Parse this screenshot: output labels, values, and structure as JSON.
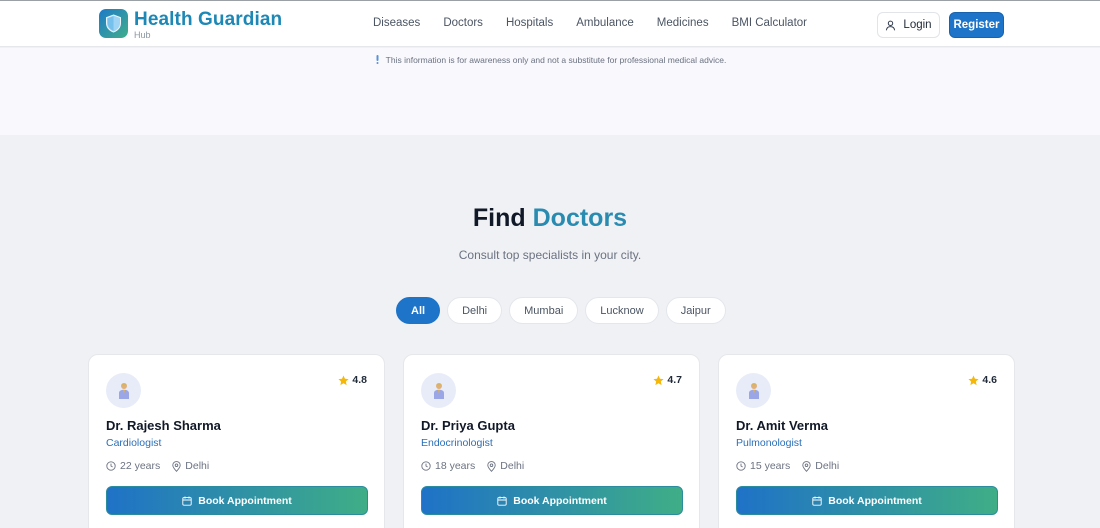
{
  "brand": {
    "title": "Health Guardian",
    "subtitle": "Hub",
    "accent": "#1d87b5"
  },
  "nav": {
    "links": [
      "Diseases",
      "Doctors",
      "Hospitals",
      "Ambulance",
      "Medicines",
      "BMI Calculator"
    ],
    "login_label": "Login",
    "register_label": "Register"
  },
  "disclaimer": "This information is for awareness only and not a substitute for professional medical advice.",
  "section": {
    "title_plain": "Find",
    "title_accent": "Doctors",
    "subtitle": "Consult top specialists in your city."
  },
  "filters": {
    "items": [
      "All",
      "Delhi",
      "Mumbai",
      "Lucknow",
      "Jaipur"
    ],
    "active": "All"
  },
  "doctors": [
    {
      "name": "Dr. Rajesh Sharma",
      "specialty": "Cardiologist",
      "rating": "4.8",
      "experience": "22 years",
      "city": "Delhi",
      "button": "Book Appointment"
    },
    {
      "name": "Dr. Priya Gupta",
      "specialty": "Endocrinologist",
      "rating": "4.7",
      "experience": "18 years",
      "city": "Delhi",
      "button": "Book Appointment"
    },
    {
      "name": "Dr. Amit Verma",
      "specialty": "Pulmonologist",
      "rating": "4.6",
      "experience": "15 years",
      "city": "Delhi",
      "button": "Book Appointment"
    }
  ],
  "icons": {
    "logo": "shield-icon",
    "login": "user-icon",
    "disclaimer": "info-icon",
    "avatar": "doctor-icon",
    "rating": "star-icon",
    "experience": "clock-icon",
    "location": "map-pin-icon",
    "book": "calendar-icon"
  },
  "colors": {
    "primary": "#1d74c9",
    "gradient_end": "#3fae86",
    "star": "#f5b70a",
    "specialty": "#2b6fb8"
  }
}
